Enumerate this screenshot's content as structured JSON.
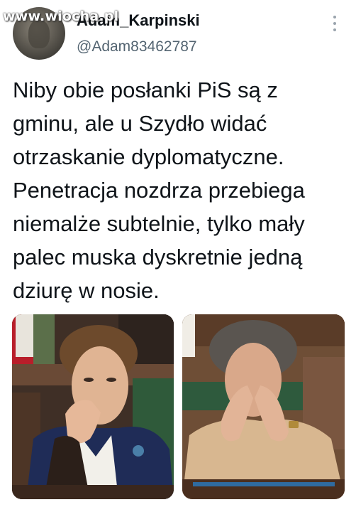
{
  "watermark": "www.wiocha.pl",
  "user": {
    "display_name": "Adam_Karpinski",
    "handle": "@Adam83462787",
    "avatar_icon": "avatar-photo"
  },
  "more_icon": "more-vertical-icon",
  "tweet": {
    "text": "Niby obie posłanki PiS są z\ngminu, ale u Szydło widać\notrzaskanie dyplomatyczne.\nPenetracja nozdrza przebiega\nniemalże subtelnie, tylko mały\npalec muska dyskretnie jedną\ndziurę w nosie."
  },
  "colors": {
    "name": "#0f1419",
    "handle": "#536471",
    "background": "#ffffff"
  }
}
